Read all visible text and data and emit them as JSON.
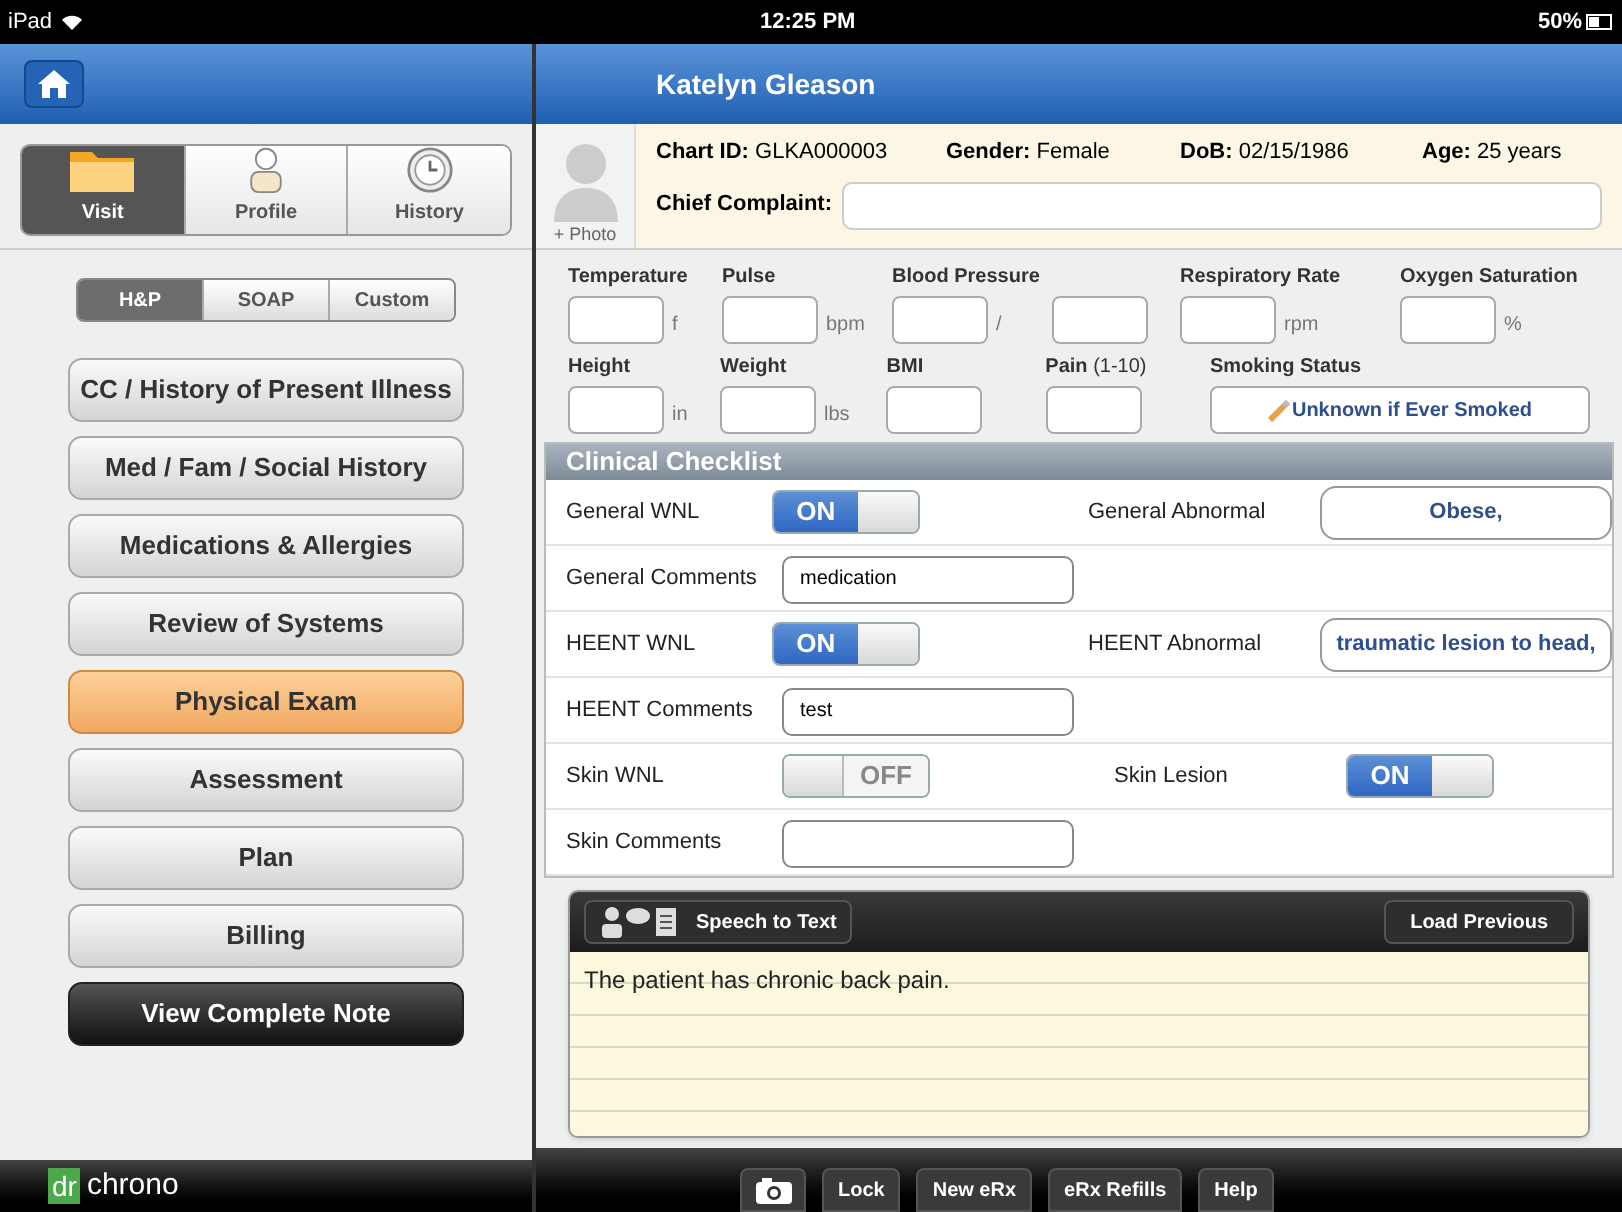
{
  "status_bar": {
    "device": "iPad",
    "time": "12:25 PM",
    "battery": "50%"
  },
  "header": {
    "patient_name": "Katelyn Gleason"
  },
  "top_tabs": [
    {
      "label": "Visit",
      "selected": true
    },
    {
      "label": "Profile",
      "selected": false
    },
    {
      "label": "History",
      "selected": false
    }
  ],
  "note_types": [
    {
      "label": "H&P",
      "selected": true
    },
    {
      "label": "SOAP",
      "selected": false
    },
    {
      "label": "Custom",
      "selected": false
    }
  ],
  "sections": [
    {
      "label": "CC / History of Present Illness",
      "kind": "section",
      "selected": false
    },
    {
      "label": "Med / Fam / Social History",
      "kind": "section",
      "selected": false
    },
    {
      "label": "Medications & Allergies",
      "kind": "section",
      "selected": false
    },
    {
      "label": "Review of Systems",
      "kind": "section",
      "selected": false
    },
    {
      "label": "Physical Exam",
      "kind": "section",
      "selected": true
    },
    {
      "label": "Assessment",
      "kind": "section",
      "selected": false
    },
    {
      "label": "Plan",
      "kind": "section",
      "selected": false
    },
    {
      "label": "Billing",
      "kind": "section",
      "selected": false
    }
  ],
  "complete_note_button": "View Complete Note",
  "logo": {
    "mark": "dr",
    "word": "chrono"
  },
  "patient": {
    "photo_label": "+ Photo",
    "fields": [
      {
        "label": "Chart ID:",
        "value": "GLKA000003"
      },
      {
        "label": "Gender:",
        "value": "Female"
      },
      {
        "label": "DoB:",
        "value": "02/15/1986"
      },
      {
        "label": "Age:",
        "value": "25 years"
      }
    ],
    "chief_complaint_label": "Chief Complaint:"
  },
  "vitals_row1": [
    {
      "label": "Temperature",
      "unit": "f"
    },
    {
      "label": "Pulse",
      "unit": "bpm"
    },
    {
      "label": "Blood Pressure",
      "unit": "/",
      "second": true
    },
    {
      "label": "Respiratory Rate",
      "unit": "rpm"
    },
    {
      "label": "Oxygen Saturation",
      "unit": "%"
    }
  ],
  "vitals_row2": [
    {
      "label": "Height",
      "unit": "in"
    },
    {
      "label": "Weight",
      "unit": "lbs"
    },
    {
      "label": "BMI"
    },
    {
      "label": "Pain",
      "hint": "(1-10)"
    }
  ],
  "smoking": {
    "label": "Smoking Status",
    "value": "Unknown if Ever Smoked"
  },
  "checklist": {
    "title": "Clinical Checklist",
    "rows": [
      {
        "label": "General WNL",
        "kind": "switch",
        "on": true,
        "switch_label": "ON",
        "right": {
          "label": "General Abnormal",
          "kind": "pick",
          "value": "Obese,"
        }
      },
      {
        "label": "General Comments",
        "kind": "text",
        "value": "medication"
      },
      {
        "label": "HEENT WNL",
        "kind": "switch",
        "on": true,
        "switch_label": "ON",
        "right": {
          "label": "HEENT Abnormal",
          "kind": "pick",
          "value": "traumatic lesion to head,"
        }
      },
      {
        "label": "HEENT Comments",
        "kind": "text",
        "value": "test"
      },
      {
        "label": "Skin WNL",
        "kind": "switch",
        "on": false,
        "switch_label": "OFF",
        "right": {
          "label": "Skin Lesion",
          "kind": "switch",
          "on": true,
          "switch_label": "ON"
        }
      },
      {
        "label": "Skin Comments",
        "kind": "text"
      }
    ]
  },
  "notes": {
    "speech_button": "Speech to Text",
    "load_button": "Load Previous",
    "text": "The patient has chronic back pain."
  },
  "toolbar": [
    {
      "kind": "camera"
    },
    {
      "kind": "text",
      "label": "Lock"
    },
    {
      "kind": "text",
      "label": "New eRx"
    },
    {
      "kind": "text",
      "label": "eRx Refills"
    },
    {
      "kind": "text",
      "label": "Help"
    }
  ]
}
